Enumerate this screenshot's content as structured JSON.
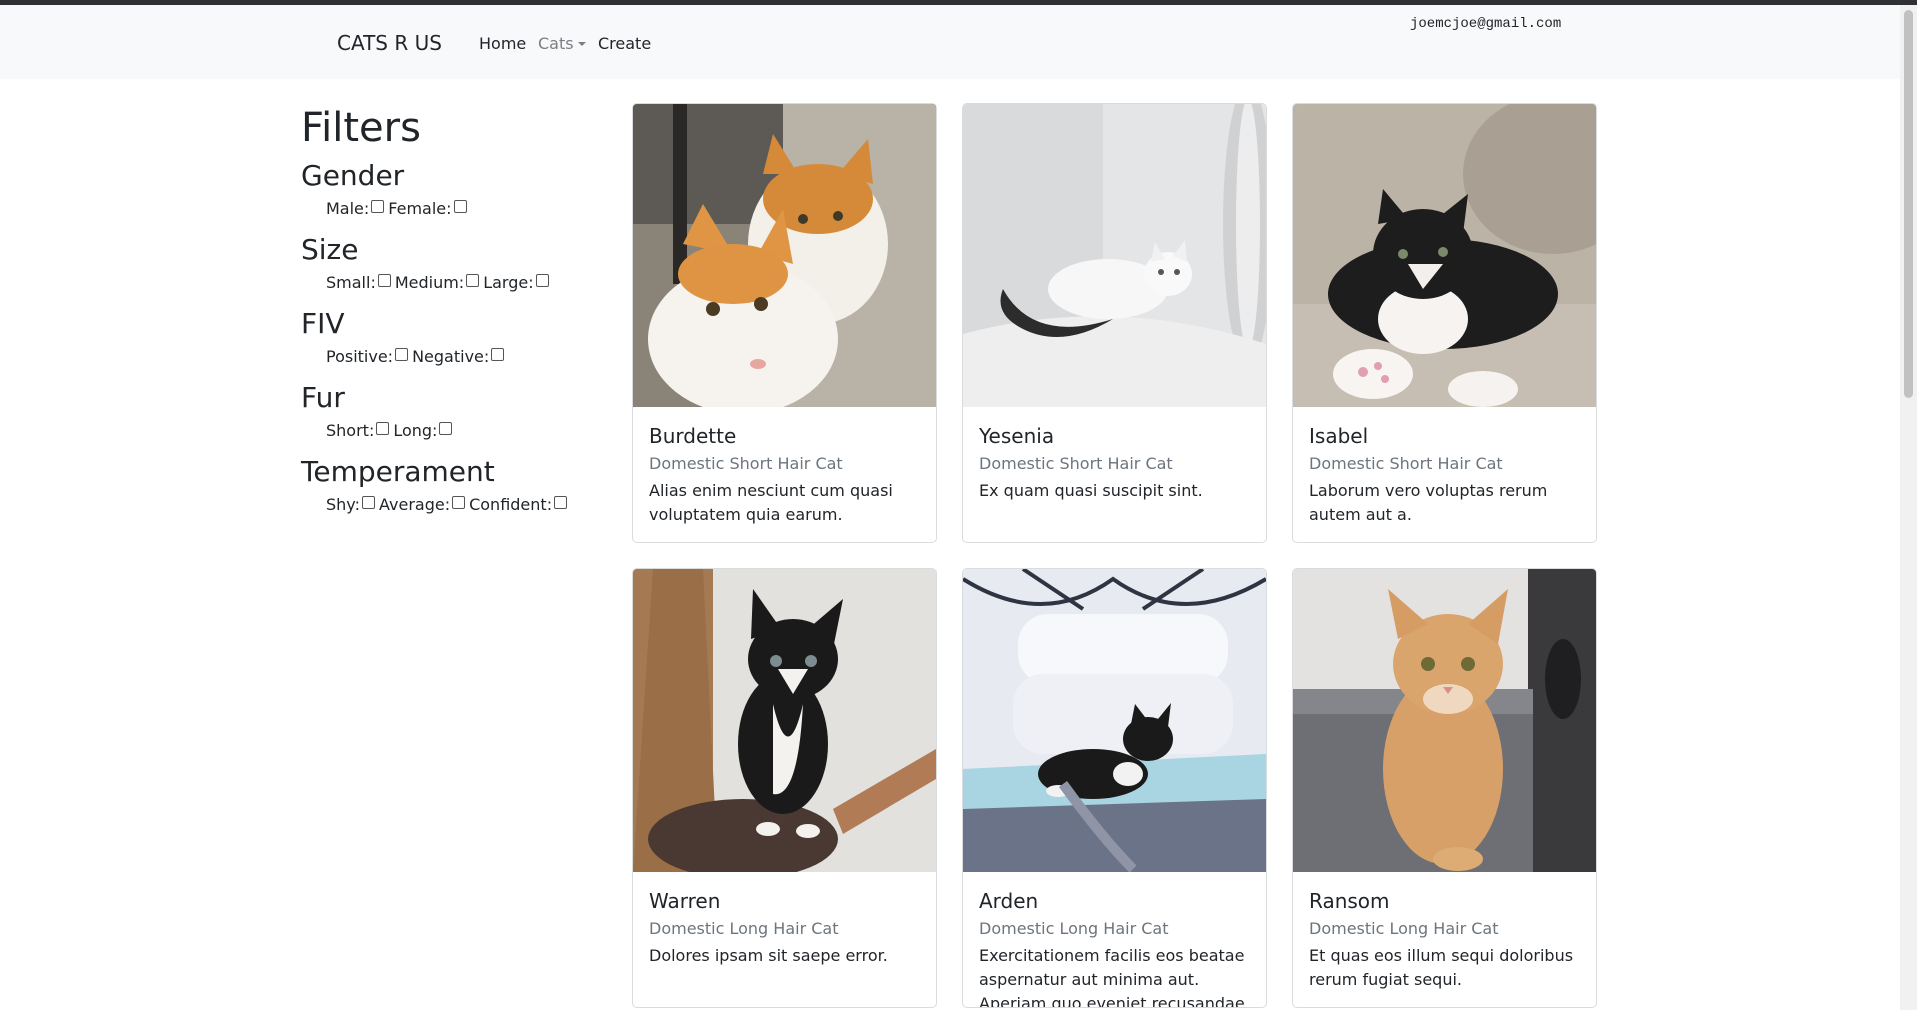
{
  "navbar": {
    "brand": "CATS R US",
    "links": [
      {
        "label": "Home"
      },
      {
        "label": "Cats"
      },
      {
        "label": "Create"
      }
    ],
    "user_email": "joemcjoe@gmail.com"
  },
  "filters": {
    "title": "Filters",
    "groups": [
      {
        "title": "Gender",
        "options": [
          "Male:",
          "Female:"
        ]
      },
      {
        "title": "Size",
        "options": [
          "Small:",
          "Medium:",
          "Large:"
        ]
      },
      {
        "title": "FIV",
        "options": [
          "Positive:",
          "Negative:"
        ]
      },
      {
        "title": "Fur",
        "options": [
          "Short:",
          "Long:"
        ]
      },
      {
        "title": "Temperament",
        "options": [
          "Shy:",
          "Average:",
          "Confident:"
        ]
      }
    ]
  },
  "cats": [
    {
      "name": "Burdette",
      "breed": "Domestic Short Hair Cat",
      "description": "Alias enim nesciunt cum quasi voluptatem quia earum."
    },
    {
      "name": "Yesenia",
      "breed": "Domestic Short Hair Cat",
      "description": "Ex quam quasi suscipit sint."
    },
    {
      "name": "Isabel",
      "breed": "Domestic Short Hair Cat",
      "description": "Laborum vero voluptas rerum autem aut a."
    },
    {
      "name": "Warren",
      "breed": "Domestic Long Hair Cat",
      "description": "Dolores ipsam sit saepe error."
    },
    {
      "name": "Arden",
      "breed": "Domestic Long Hair Cat",
      "description": "Exercitationem facilis eos beatae aspernatur aut minima aut. Aperiam quo eveniet recusandae odio minus."
    },
    {
      "name": "Ransom",
      "breed": "Domestic Long Hair Cat",
      "description": "Et quas eos illum sequi doloribus rerum fugiat sequi."
    }
  ]
}
